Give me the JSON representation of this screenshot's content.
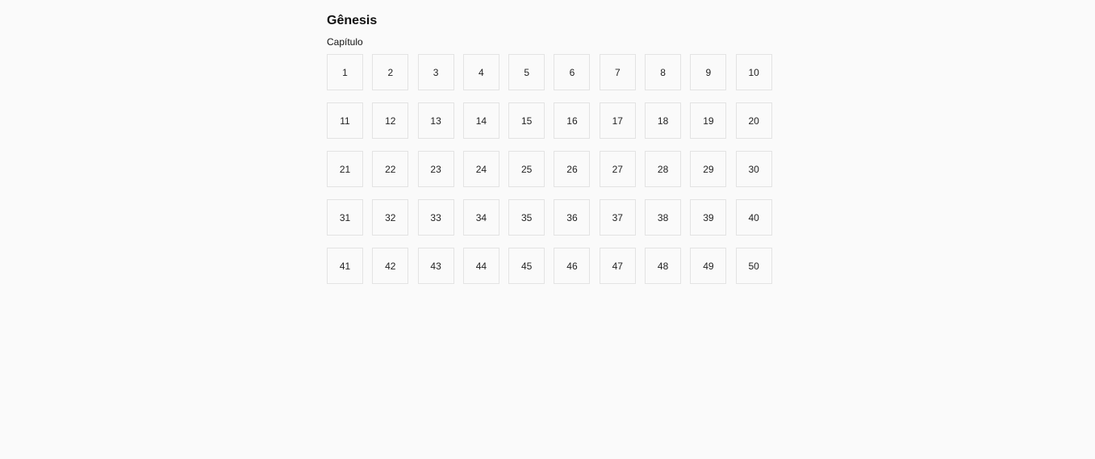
{
  "book": {
    "title": "Gênesis",
    "chapter_label": "Capítulo"
  },
  "chapters": [
    "1",
    "2",
    "3",
    "4",
    "5",
    "6",
    "7",
    "8",
    "9",
    "10",
    "11",
    "12",
    "13",
    "14",
    "15",
    "16",
    "17",
    "18",
    "19",
    "20",
    "21",
    "22",
    "23",
    "24",
    "25",
    "26",
    "27",
    "28",
    "29",
    "30",
    "31",
    "32",
    "33",
    "34",
    "35",
    "36",
    "37",
    "38",
    "39",
    "40",
    "41",
    "42",
    "43",
    "44",
    "45",
    "46",
    "47",
    "48",
    "49",
    "50"
  ],
  "colors": {
    "background": "#fafafa",
    "button_border": "#e3e3e3",
    "text": "#111111"
  }
}
